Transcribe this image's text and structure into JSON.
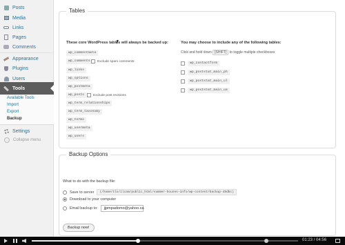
{
  "sidebar": {
    "items": [
      {
        "label": "Posts",
        "icon": "pushpin-icon"
      },
      {
        "label": "Media",
        "icon": "media-icon"
      },
      {
        "label": "Links",
        "icon": "links-icon"
      },
      {
        "label": "Pages",
        "icon": "pages-icon"
      },
      {
        "label": "Comments",
        "icon": "comments-icon"
      },
      {
        "label": "Appearance",
        "icon": "appearance-icon"
      },
      {
        "label": "Plugins",
        "icon": "plugins-icon"
      },
      {
        "label": "Users",
        "icon": "users-icon"
      },
      {
        "label": "Tools",
        "icon": "tools-icon"
      },
      {
        "label": "Settings",
        "icon": "settings-icon"
      }
    ],
    "submenu": [
      "Available Tools",
      "Import",
      "Export",
      "Backup"
    ],
    "collapse_label": "Collapse menu"
  },
  "tables": {
    "legend": "Tables",
    "core_heading": "These core WordPress tables will always be backed up:",
    "core_tables": [
      "wp_commentmeta",
      "wp_comments",
      "wp_links",
      "wp_options",
      "wp_postmeta",
      "wp_posts",
      "wp_term_relationships",
      "wp_term_taxonomy",
      "wp_terms",
      "wp_usermeta",
      "wp_users"
    ],
    "exclude_spam_label": "Exclude spam comments",
    "exclude_revisions_label": "Exclude post revisions",
    "optional_heading": "You may choose to include any of the following tables:",
    "optional_hint_pre": "Click and hold down",
    "optional_hint_key": "[SHIFT]",
    "optional_hint_post": "to toggle multiple checkboxes",
    "optional_tables": [
      "wp_contactform",
      "wp_poststat_main_ph",
      "wp_poststat_main_ul",
      "wp_poststat_main_ua"
    ]
  },
  "backup_options": {
    "legend": "Backup Options",
    "question": "What to do with the backup file:",
    "save_label": "Save to server",
    "save_path": "(/home/tlo/ilcam/public_html/summer-houses-info/wp-content/backup-49dbc)",
    "download_label": "Download to your computer",
    "email_label": "Email backup to:",
    "email_value": "jjpmpadomo@yahoo.ca",
    "selected": "download",
    "button_label": "Backup now!"
  },
  "video": {
    "time": "01:23 / 04:56",
    "progress": 0.4,
    "knob2": 0.88
  }
}
